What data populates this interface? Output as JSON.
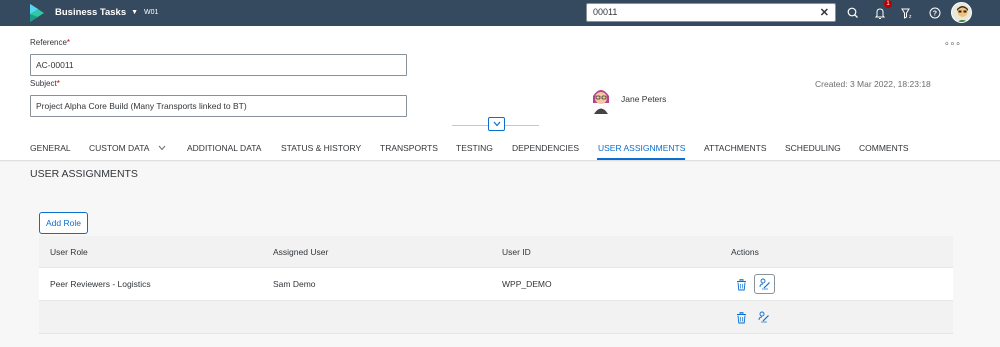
{
  "shell": {
    "app_title": "Business Tasks",
    "sub_title": "W01",
    "search_value": "00011",
    "notification_count": "1",
    "logo_icon": "sap-logo-icon",
    "icons": [
      "search-icon",
      "bell-icon",
      "filter-icon",
      "help-icon",
      "user-avatar"
    ]
  },
  "header": {
    "reference_label": "Reference",
    "reference_value": "AC-00011",
    "subject_label": "Subject",
    "subject_value": "Project Alpha Core Build (Many Transports linked to BT)",
    "required_marker": "*",
    "created": "Created: 3 Mar 2022, 18:23:18",
    "person_name": "Jane Peters",
    "overflow": "∘∘∘"
  },
  "tabs": [
    {
      "label": "GENERAL"
    },
    {
      "label": "CUSTOM DATA"
    },
    {
      "label": "ADDITIONAL DATA"
    },
    {
      "label": "STATUS & HISTORY"
    },
    {
      "label": "TRANSPORTS"
    },
    {
      "label": "TESTING"
    },
    {
      "label": "DEPENDENCIES"
    },
    {
      "label": "USER ASSIGNMENTS",
      "active": true
    },
    {
      "label": "ATTACHMENTS"
    },
    {
      "label": "SCHEDULING"
    },
    {
      "label": "COMMENTS"
    }
  ],
  "content": {
    "section_title": "USER ASSIGNMENTS",
    "add_role_label": "Add Role",
    "columns": [
      "User Role",
      "Assigned User",
      "User ID",
      "Actions"
    ],
    "rows": [
      {
        "role": "Peer Reviewers - Logistics",
        "user": "Sam Demo",
        "user_id": "WPP_DEMO"
      },
      {
        "role": "",
        "user": "",
        "user_id": ""
      }
    ]
  },
  "colors": {
    "shell_bg": "#354a5f",
    "accent": "#0a6ed1",
    "required": "#bb0000"
  }
}
